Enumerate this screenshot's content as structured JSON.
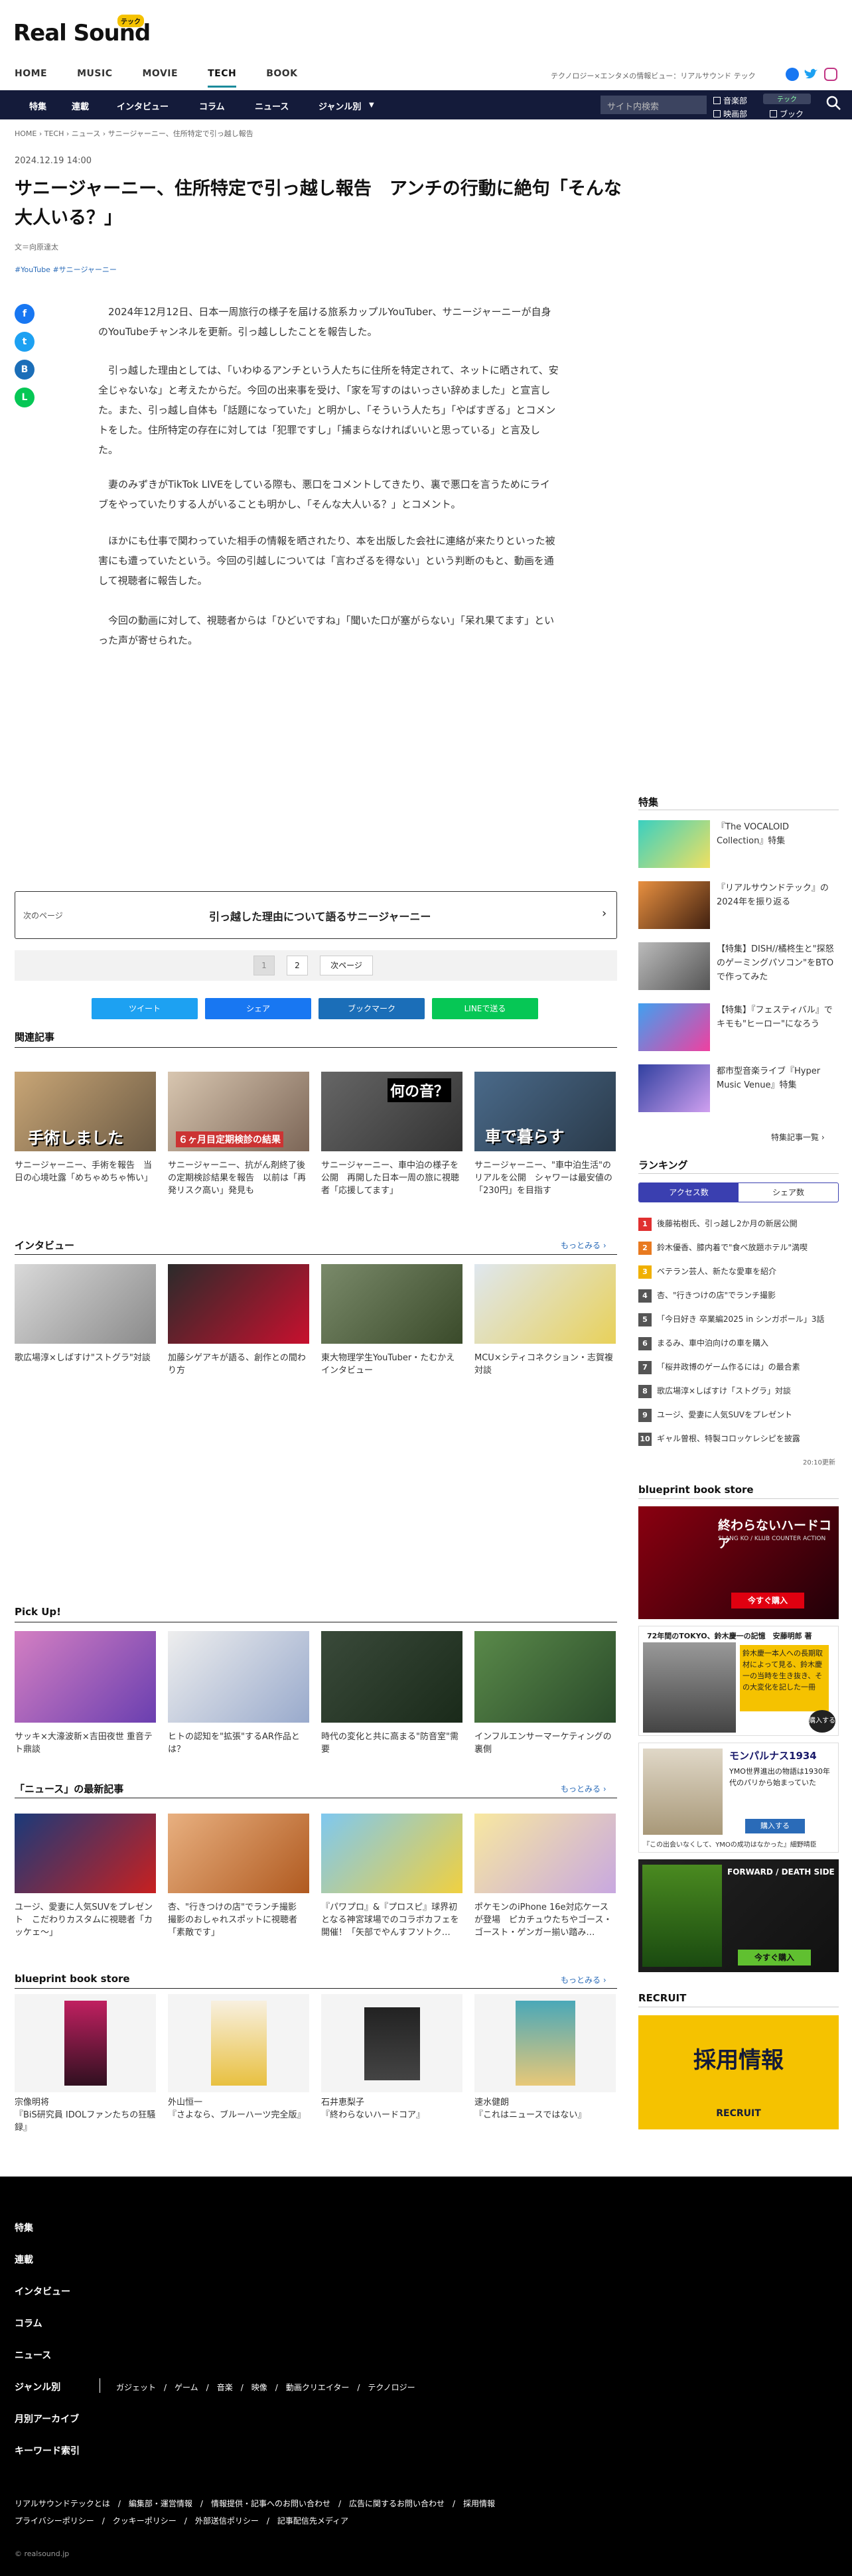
{
  "header": {
    "logo": "Real Sound",
    "logo_badge": "テック",
    "tagline": "テクノロジー×エンタメの情報ビュー：リアルサウンド テック",
    "nav": [
      "HOME",
      "MUSIC",
      "MOVIE",
      "TECH",
      "BOOK"
    ],
    "subnav": [
      "特集",
      "連載",
      "インタビュー",
      "コラム",
      "ニュース",
      "ジャンル別"
    ],
    "search_placeholder": "サイト内検索",
    "checks": [
      "音楽部",
      "映画部",
      "テック",
      "ブック"
    ],
    "pill": "テック"
  },
  "breadcrumb": "HOME  ›  TECH  ›  ニュース  ›  サニージャーニー、住所特定で引っ越し報告",
  "article": {
    "date": "2024.12.19 14:00",
    "title": "サニージャーニー、住所特定で引っ越し報告　アンチの行動に絶句「そんな大人いる？」",
    "author": "文＝向原達太",
    "tags": "#YouTube #サニージャーニー",
    "paragraphs": [
      "2024年12月12日、日本一周旅行の様子を届ける旅系カップルYouTuber、サニージャーニーが自身のYouTubeチャンネルを更新。引っ越ししたことを報告した。",
      "引っ越した理由としては、「いわゆるアンチという人たちに住所を特定されて、ネットに晒されて、安全じゃないな」と考えたからだ。今回の出来事を受け、「家を写すのはいっさい辞めました」と宣言した。また、引っ越し自体も「話題になっていた」と明かし、「そういう人たち」「やばすぎる」とコメントをした。住所特定の存在に対しては「犯罪ですし」「捕まらなければいいと思っている」と言及した。",
      "妻のみずきがTikTok LIVEをしている際も、悪口をコメントしてきたり、裏で悪口を言うためにライブをやっていたりする人がいることも明かし、「そんな大人いる？」とコメント。",
      "ほかにも仕事で関わっていた相手の情報を晒されたり、本を出版した会社に連絡が来たりといった被害にも遭っていたという。今回の引越しについては「言わざるを得ない」という判断のもと、動画を通して視聴者に報告した。",
      "今回の動画に対して、視聴者からは「ひどいですね」「聞いた口が塞がらない」「呆れ果てます」といった声が寄せられた。"
    ]
  },
  "next_page": {
    "label": "次のページ",
    "title": "引っ越した理由について語るサニージャーニー"
  },
  "pager": [
    "1",
    "2",
    "次ページ"
  ],
  "share": [
    "ツイート",
    "シェア",
    "ブックマーク",
    "LINEで送る"
  ],
  "related": {
    "heading": "関連記事",
    "items": [
      {
        "cap": "サニージャーニー、手術を報告　当日の心境吐露「めちゃめちゃ怖い」",
        "ov": "手術しました"
      },
      {
        "cap": "サニージャーニー、抗がん剤終了後の定期検診結果を報告　以前は「再発リスク高い」発見も",
        "ov": "６ヶ月目定期検診の結果"
      },
      {
        "cap": "サニージャーニー、車中泊の様子を公開　再開した日本一周の旅に視聴者「応援してます」",
        "ov": "何の音？"
      },
      {
        "cap": "サニージャーニー、\"車中泊生活\"のリアルを公開　シャワーは最安値の「230円」を目指す",
        "ov": "車で暮らす"
      }
    ]
  },
  "interview": {
    "heading": "インタビュー",
    "more": "もっとみる ›",
    "items": [
      "歌広場淳×しばすけ\"ストグラ\"対談",
      "加藤シゲアキが語る、創作との間わり方",
      "東大物理学生YouTuber・たむかえインタビュー",
      "MCU×シティコネクション・志賀複対談"
    ]
  },
  "pickup": {
    "heading": "Pick Up!",
    "items": [
      "サッキ×大濠波新×吉田夜世 重音テト鼎談",
      "ヒトの認知を\"拡張\"するAR作品とは？",
      "時代の変化と共に高まる\"防音室\"需要",
      "インフルエンサーマーケティングの裏側"
    ]
  },
  "latest": {
    "heading": "「ニュース」の最新記事",
    "more": "もっとみる ›",
    "items": [
      "ユージ、愛妻に人気SUVをプレゼント　こだわりカスタムに視聴者「カッケェ～」",
      "杏、\"行きつけの店\"でランチ撮影　撮影のおしゃれスポットに視聴者「素敵です」",
      "『パワプロ』&『プロスピ』球界初となる神宮球場でのコラボカフェを開催！「矢部でやんすフソトク…",
      "ポケモンのiPhone 16e対応ケースが登場　ピカチュウたちやゴース・ゴースト・ゲンガー揃い踏み…"
    ]
  },
  "blueprint": {
    "heading": "blueprint book store",
    "more": "もっとみる ›",
    "items": [
      {
        "a": "宗像明将",
        "t": "『BiS研究員 IDOLファンたちの狂騒録』"
      },
      {
        "a": "外山恒一",
        "t": "『さよなら、ブルーハーツ完全版』"
      },
      {
        "a": "石井恵梨子",
        "t": "『終わらないハードコア』"
      },
      {
        "a": "速水健朗",
        "t": "『これはニュースではない』"
      }
    ]
  },
  "sidebar": {
    "feature_heading": "特集",
    "feature_more": "特集記事一覧 ›",
    "features": [
      "『The VOCALOID Collection』特集",
      "『リアルサウンドテック』の2024年を振り返る",
      "【特集】DISH//橘柊生と\"探怒のゲーミングパソコン\"をBTOで作ってみた",
      "【特集】『フェスティバル』でキモも\"ヒーロー\"になろう",
      "都市型音楽ライブ『Hyper Music Venue』特集"
    ],
    "ranking_heading": "ランキング",
    "rank_tabs": [
      "アクセス数",
      "シェア数"
    ],
    "ranks": [
      "後藤祐樹氏、引っ越し2か月の新居公開",
      "鈴木優香、膝内着で\"食べ放題ホテル\"満喫",
      "ベテラン芸人、新たな愛車を紹介",
      "杏、\"行きつけの店\"でランチ撮影",
      "「今日好き 卒業編2025 in シンガポール」3話",
      "まるみ、車中泊向けの車を購入",
      "「桜井政博のゲーム作るには」の最合素",
      "歌広場淳×しばすけ「ストグラ」対談",
      "ユージ、愛妻に人気SUVをプレゼント",
      "ギャル曽根、特製コロッケレシピを披露"
    ],
    "rank_time": "20:10更新",
    "bp_heading": "blueprint book store",
    "bp1_title": "終わらないハードコア",
    "bp1_sub": "SLANG KO / KLUB COUNTER ACTION",
    "bp1_btn": "今すぐ購入",
    "bp2_head": "72年間のTOKYO、鈴木慶一の記憶　安藤明郎 著",
    "bp2_body": "鈴木慶一本人への長期取材によって見る、鈴木慶一の当時を生き抜き、その大変化を記した一冊",
    "bp2_btn": "購入する",
    "bp3_head": "モンパルナス1934",
    "bp3_sub": "YMO世界進出の物語は1930年代のパリから始まっていた",
    "bp3_btn": "購入する",
    "bp3_note": "『この出会いなくして、YMOの成功はなかった』細野晴臣",
    "bp4_head": "FORWARD / DEATH SIDE",
    "bp4_btn": "今すぐ購入",
    "recruit_heading": "RECRUIT",
    "recruit_text": "採用情報",
    "recruit_sub": "RECRUIT"
  },
  "footer": {
    "items": [
      "特集",
      "連載",
      "インタビュー",
      "コラム",
      "ニュース",
      "ジャンル別",
      "月別アーカイブ",
      "キーワード索引"
    ],
    "genre": "ガジェット　/　ゲーム　/　音楽　/　映像　/　動画クリエイター　/　テクノロジー",
    "links1": "リアルサウンドテックとは　/　編集部・運営情報　/　情報提供・記事へのお問い合わせ　/　広告に関するお問い合わせ　/　採用情報",
    "links2": "プライバシーポリシー　/　クッキーポリシー　/　外部送信ポリシー　/　記事配信先メディア",
    "copyright": "© realsound.jp"
  },
  "colors": {
    "navy": "#141b3a",
    "accent": "#1b8b9b",
    "link": "#2a6bb8"
  }
}
